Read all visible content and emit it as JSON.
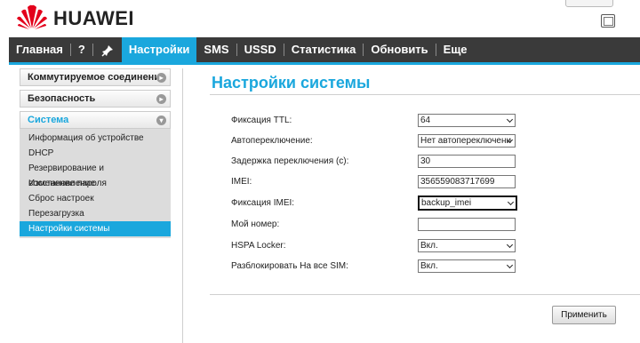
{
  "brand": {
    "name": "HUAWEI",
    "color": "#e3001b"
  },
  "nav": {
    "items": [
      "Главная",
      "?",
      "",
      "Настройки",
      "SMS",
      "USSD",
      "Статистика",
      "Обновить",
      "Еще"
    ],
    "active_index": 3,
    "accent": "#1aa7dd",
    "icon_item": "pin-icon"
  },
  "sidebar": {
    "sections": [
      {
        "label": "Коммутируемое соединение",
        "expanded": false
      },
      {
        "label": "Безопасность",
        "expanded": false
      },
      {
        "label": "Система",
        "expanded": true
      }
    ],
    "items": [
      "Информация об устройстве",
      "DHCP",
      "Резервирование и восстановление",
      "Изменение пароля",
      "Сброс настроек",
      "Перезагрузка",
      "Настройки системы"
    ],
    "active_item": "Настройки системы"
  },
  "main": {
    "title": "Настройки системы",
    "fields": [
      {
        "label": "Фиксация TTL:",
        "value": "64",
        "type": "select"
      },
      {
        "label": "Автопереключение:",
        "value": "Нет автопереключени",
        "type": "select"
      },
      {
        "label": "Задержка переключения (с):",
        "value": "30",
        "type": "input"
      },
      {
        "label": "IMEI:",
        "value": "356559083717699",
        "type": "input"
      },
      {
        "label": "Фиксация IMEI:",
        "value": "backup_imei",
        "type": "select"
      },
      {
        "label": "Мой номер:",
        "value": "",
        "type": "input"
      },
      {
        "label": "HSPA Locker:",
        "value": "Вкл.",
        "type": "select"
      },
      {
        "label": "Разблокировать На все SIM:",
        "value": "Вкл.",
        "type": "select"
      }
    ],
    "apply_label": "Применить"
  }
}
